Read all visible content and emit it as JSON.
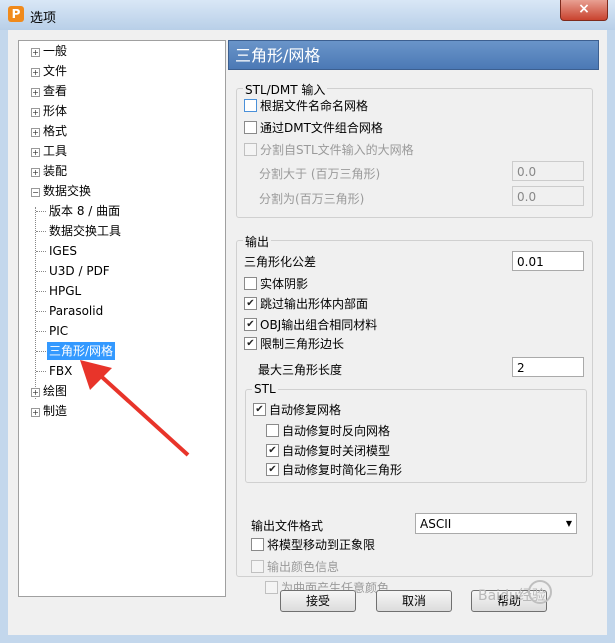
{
  "window": {
    "title": "选项",
    "close_icon": "×"
  },
  "tree": {
    "items": [
      {
        "label": "一般",
        "expander": "+"
      },
      {
        "label": "文件",
        "expander": "+"
      },
      {
        "label": "查看",
        "expander": "+"
      },
      {
        "label": "形体",
        "expander": "+"
      },
      {
        "label": "格式",
        "expander": "+"
      },
      {
        "label": "工具",
        "expander": "+"
      },
      {
        "label": "装配",
        "expander": "+"
      },
      {
        "label": "数据交换",
        "expander": "−"
      },
      {
        "label": "版本 8 / 曲面"
      },
      {
        "label": "数据交换工具"
      },
      {
        "label": "IGES"
      },
      {
        "label": "U3D / PDF"
      },
      {
        "label": "HPGL"
      },
      {
        "label": "Parasolid"
      },
      {
        "label": "PIC"
      },
      {
        "label": "三角形/网格",
        "selected": true
      },
      {
        "label": "FBX"
      },
      {
        "label": "绘图",
        "expander": "+"
      },
      {
        "label": "制造",
        "expander": "+"
      }
    ]
  },
  "panel": {
    "title": "三角形/网格",
    "stl_input": {
      "group_label": "STL/DMT 输入",
      "name_by_filename": "根据文件名命名网格",
      "combine_via_dmt": "通过DMT文件组合网格",
      "split_large": "分割自STL文件输入的大网格",
      "split_greater_label": "分割大于 (百万三角形)",
      "split_greater_value": "0.0",
      "split_into_label": "分割为(百万三角形)",
      "split_into_value": "0.0"
    },
    "output": {
      "group_label": "输出",
      "tolerance_label": "三角形化公差",
      "tolerance_value": "0.01",
      "solid_shading": "实体阴影",
      "skip_internal": "跳过输出形体内部面",
      "obj_combine": "OBJ输出组合相同材料",
      "limit_edge": "限制三角形边长",
      "max_edge_label": "最大三角形长度",
      "max_edge_value": "2",
      "stl": {
        "group_label": "STL",
        "auto_repair": "自动修复网格",
        "reverse_on_repair": "自动修复时反向网格",
        "close_model": "自动修复时关闭模型",
        "simplify": "自动修复时简化三角形"
      },
      "format_label": "输出文件格式",
      "format_value": "ASCII",
      "move_to_positive": "将模型移动到正象限",
      "export_color": "输出颜色信息",
      "random_color": "为曲面产生任意颜色"
    }
  },
  "buttons": {
    "accept": "接受",
    "cancel": "取消",
    "help": "帮助"
  },
  "watermark": "Baidu经验"
}
